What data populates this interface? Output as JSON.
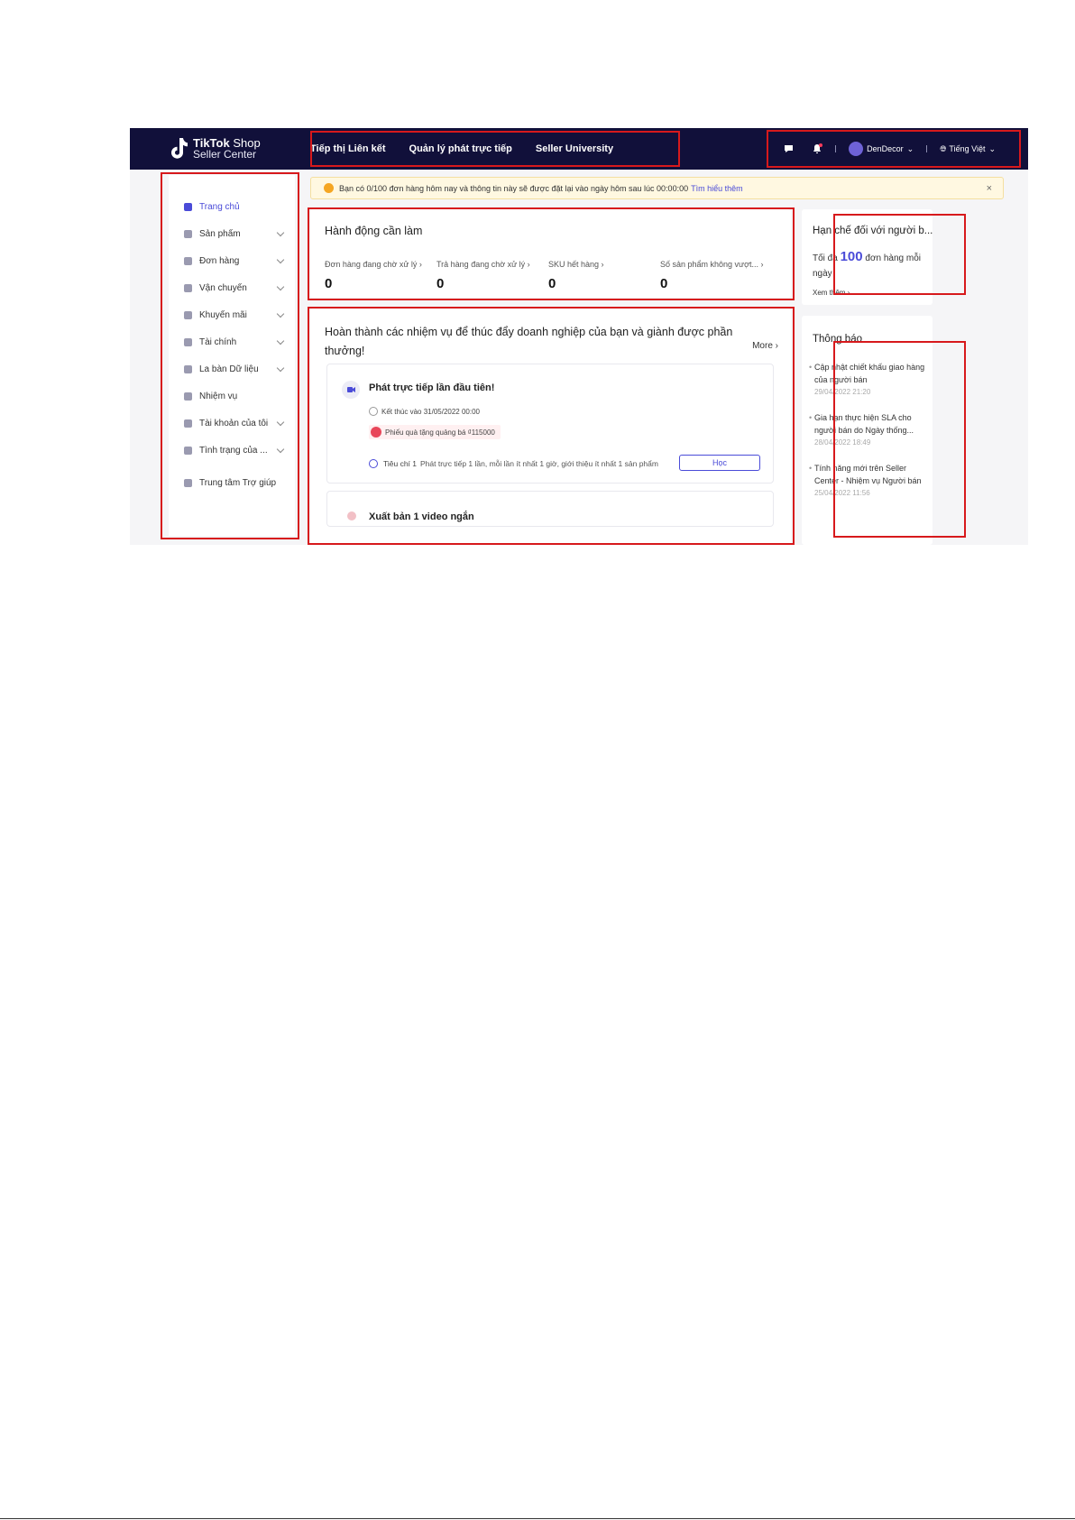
{
  "logo": {
    "line1_bold": "TikTok",
    "line1_rest": "Shop",
    "line2": "Seller Center"
  },
  "topnav": [
    "Tiếp thị Liên kết",
    "Quản lý phát trực tiếp",
    "Seller University"
  ],
  "topright": {
    "shop_name": "DenDecor",
    "language": "Tiếng Việt"
  },
  "sidebar": {
    "items": [
      {
        "label": "Trang chủ",
        "active": true
      },
      {
        "label": "Sản phẩm"
      },
      {
        "label": "Đơn hàng"
      },
      {
        "label": "Vận chuyển"
      },
      {
        "label": "Khuyến mãi"
      },
      {
        "label": "Tài chính"
      },
      {
        "label": "La bàn Dữ liệu"
      },
      {
        "label": "Nhiệm vụ"
      },
      {
        "label": "Tài khoản của tôi"
      },
      {
        "label": "Tình trạng của ..."
      },
      {
        "label": "Trung tâm Trợ giúp"
      }
    ]
  },
  "alert": {
    "text": "Bạn có 0/100 đơn hàng hôm nay và thông tin này sẽ được đặt lại vào ngày hôm sau lúc 00:00:00",
    "link": "Tìm hiểu thêm",
    "close": "×"
  },
  "actions": {
    "title": "Hành động cần làm",
    "stats": [
      {
        "label": "Đơn hàng đang chờ xử lý ›",
        "value": "0"
      },
      {
        "label": "Trả hàng đang chờ xử lý ›",
        "value": "0"
      },
      {
        "label": "SKU hết hàng ›",
        "value": "0"
      },
      {
        "label": "Số sản phẩm không vượt... ›",
        "value": "0"
      }
    ]
  },
  "tasks": {
    "title_line1": "Hoàn thành các nhiệm vụ để thúc đẩy doanh nghiệp của bạn và giành được phần",
    "title_line2": "thưởng!",
    "more": "More ›",
    "task1": {
      "title": "Phát trực tiếp lần đầu tiên!",
      "deadline": "Kết thúc vào 31/05/2022 00:00",
      "reward": "Phiếu quà tặng quảng bá ₫115000",
      "criteria_prefix": "Tiêu chí 1",
      "criteria": "Phát trực tiếp 1 lần, mỗi lần ít nhất 1 giờ, giới thiệu ít nhất 1 sản phẩm",
      "button": "Học"
    },
    "task2": {
      "title": "Xuất bản 1 video ngắn"
    }
  },
  "limits": {
    "title": "Hạn chế đối với người b...",
    "prefix": "Tối đa",
    "number": "100",
    "suffix": "đơn hàng mỗi",
    "line2": "ngày",
    "link": "Xem thêm ›"
  },
  "notices": {
    "title": "Thông báo",
    "items": [
      {
        "l1": "Cập nhật chiết khấu giao hàng",
        "l2": "của người bán",
        "date": "29/04/2022 21:20"
      },
      {
        "l1": "Gia hạn thực hiện SLA cho",
        "l2": "người bán do Ngày thống...",
        "date": "28/04/2022 18:49"
      },
      {
        "l1": "Tính năng mới trên Seller",
        "l2": "Center - Nhiệm vụ Người bán",
        "date": "25/04/2022 11:56"
      }
    ]
  },
  "colors": {
    "topbar": "#11103a",
    "accent": "#4a4bd8",
    "highlight_border": "#d7191c",
    "alert_bg": "#fff8e1"
  }
}
